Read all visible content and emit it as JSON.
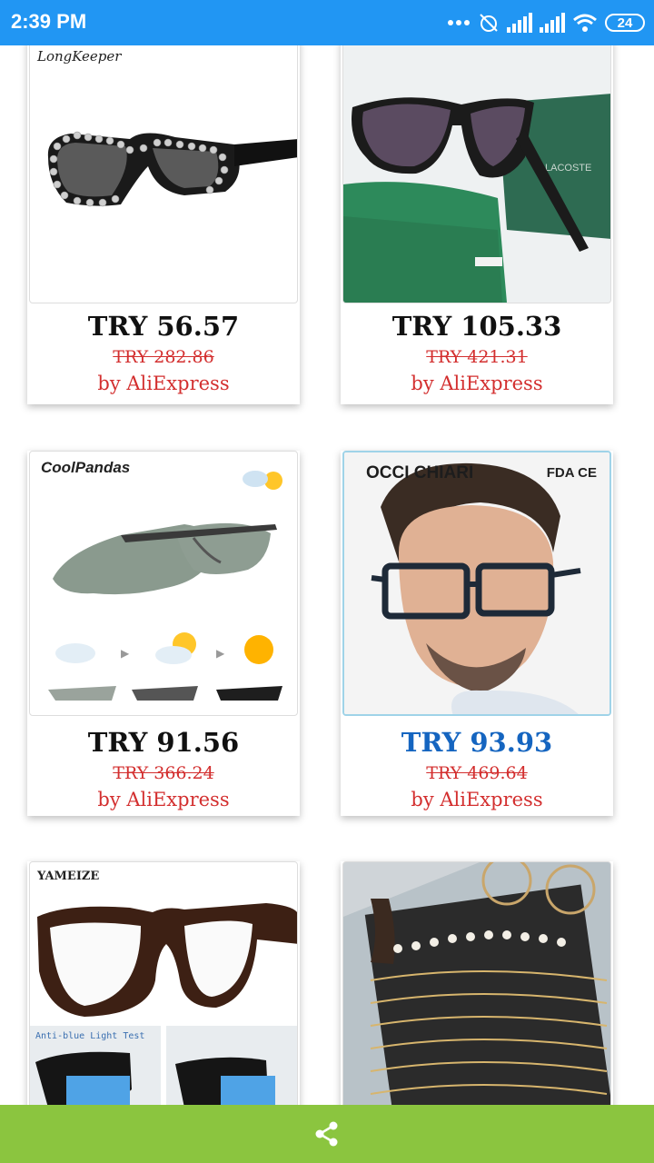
{
  "status": {
    "time": "2:39 PM",
    "battery": "24"
  },
  "products": [
    {
      "brand": "LongKeeper",
      "price": "TRY 56.57",
      "old_price": "TRY 282.86",
      "seller": "by AliExpress"
    },
    {
      "brand": "LACOSTE",
      "price": "TRY 105.33",
      "old_price": "TRY 421.31",
      "seller": "by AliExpress"
    },
    {
      "brand": "CoolPandas",
      "price": "TRY 91.56",
      "old_price": "TRY 366.24",
      "seller": "by AliExpress"
    },
    {
      "brand": "OCCI CHIARI",
      "badge": "FDA CE",
      "price": "TRY 93.93",
      "old_price": "TRY 469.64",
      "seller": "by AliExpress"
    },
    {
      "brand": "YAMEIZE",
      "caption": "Anti-blue Light Test"
    },
    {
      "brand": ""
    }
  ],
  "bottom": {
    "share_icon": "share-icon"
  }
}
